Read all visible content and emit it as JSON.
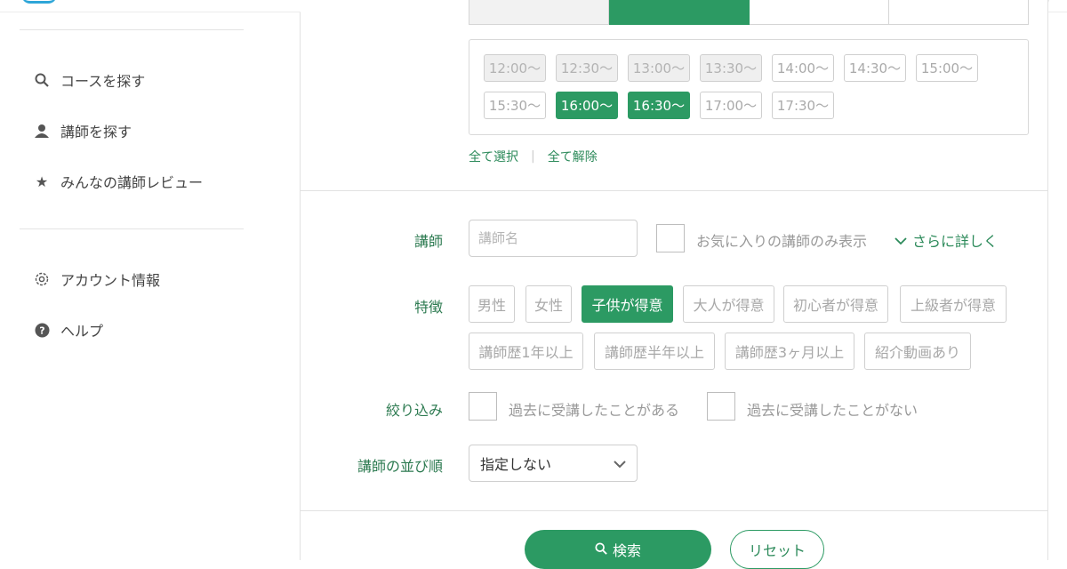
{
  "sidebar": {
    "nav": [
      {
        "label": "コースを探す",
        "icon": "search-icon"
      },
      {
        "label": "講師を探す",
        "icon": "teacher-icon"
      },
      {
        "label": "みんなの講師レビュー",
        "icon": "star-icon"
      }
    ],
    "account": [
      {
        "label": "アカウント情報",
        "icon": "gear-icon"
      },
      {
        "label": "ヘルプ",
        "icon": "help-icon"
      }
    ]
  },
  "time_filter": {
    "slots": [
      {
        "label": "12:00〜",
        "state": "disabled"
      },
      {
        "label": "12:30〜",
        "state": "disabled"
      },
      {
        "label": "13:00〜",
        "state": "disabled"
      },
      {
        "label": "13:30〜",
        "state": "disabled"
      },
      {
        "label": "14:00〜",
        "state": "off"
      },
      {
        "label": "14:30〜",
        "state": "off"
      },
      {
        "label": "15:00〜",
        "state": "off"
      },
      {
        "label": "15:30〜",
        "state": "off"
      },
      {
        "label": "16:00〜",
        "state": "on"
      },
      {
        "label": "16:30〜",
        "state": "on"
      },
      {
        "label": "17:00〜",
        "state": "off"
      },
      {
        "label": "17:30〜",
        "state": "off"
      }
    ],
    "select_all": "全て選択",
    "clear_all": "全て解除"
  },
  "teacher": {
    "label": "講師",
    "placeholder": "講師名",
    "favorites_only": "お気に入りの講師のみ表示",
    "more": "さらに詳しく"
  },
  "features": {
    "label": "特徴",
    "chips": [
      {
        "label": "男性",
        "on": false
      },
      {
        "label": "女性",
        "on": false
      },
      {
        "label": "子供が得意",
        "on": true
      },
      {
        "label": "大人が得意",
        "on": false
      },
      {
        "label": "初心者が得意",
        "on": false
      },
      {
        "label": "上級者が得意",
        "on": false
      },
      {
        "label": "講師歴1年以上",
        "on": false
      },
      {
        "label": "講師歴半年以上",
        "on": false
      },
      {
        "label": "講師歴3ヶ月以上",
        "on": false
      },
      {
        "label": "紹介動画あり",
        "on": false
      }
    ]
  },
  "narrow": {
    "label": "絞り込み",
    "taken": "過去に受講したことがある",
    "not_taken": "過去に受講したことがない"
  },
  "sort": {
    "label": "講師の並び順",
    "value": "指定しない"
  },
  "actions": {
    "search": "検索",
    "reset": "リセット"
  },
  "colors": {
    "accent": "#2c9a63",
    "link": "#2c8a5a"
  }
}
